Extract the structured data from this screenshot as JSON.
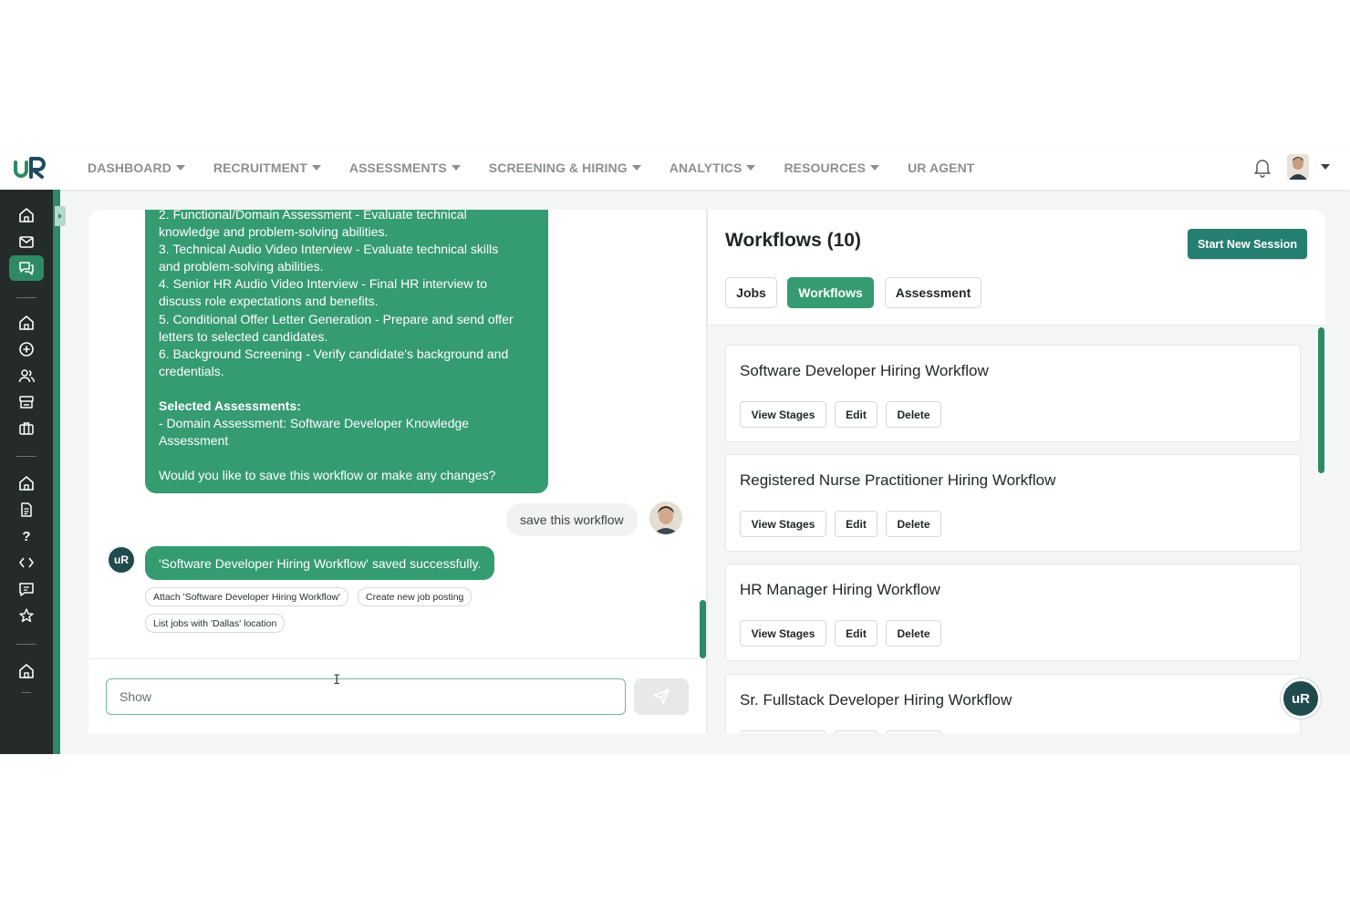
{
  "nav": {
    "items": [
      {
        "label": "DASHBOARD",
        "has_caret": true
      },
      {
        "label": "RECRUITMENT",
        "has_caret": true
      },
      {
        "label": "ASSESSMENTS",
        "has_caret": true
      },
      {
        "label": "SCREENING & HIRING",
        "has_caret": true
      },
      {
        "label": "ANALYTICS",
        "has_caret": true
      },
      {
        "label": "RESOURCES",
        "has_caret": true
      },
      {
        "label": "UR AGENT",
        "has_caret": false
      }
    ],
    "logo_text": "uR"
  },
  "sidebar": {
    "icons": [
      "home-icon",
      "mail-icon",
      "chat-icon",
      "home-icon",
      "plus-circle-icon",
      "users-icon",
      "inbox-icon",
      "briefcase-icon",
      "home-icon",
      "document-icon",
      "question-icon",
      "code-icon",
      "message-square-icon",
      "star-icon",
      "home-icon"
    ],
    "question_glyph": "?"
  },
  "chat": {
    "agent_message_lines": [
      "2. Functional/Domain Assessment - Evaluate technical",
      "knowledge and problem-solving abilities.",
      "3. Technical Audio Video Interview - Evaluate technical skills",
      "and problem-solving abilities.",
      "4. Senior HR Audio Video Interview - Final HR interview to",
      "discuss role expectations and benefits.",
      "5. Conditional Offer Letter Generation - Prepare and send offer",
      "letters to selected candidates.",
      "6. Background Screening - Verify candidate's background and",
      "credentials."
    ],
    "assessments_heading": "Selected Assessments:",
    "assessment_lines": [
      "- Domain Assessment: Software Developer Knowledge",
      "Assessment"
    ],
    "question": "Would you like to save this workflow or make any changes?",
    "user_message": "save this workflow",
    "agent_reply": "'Software Developer Hiring Workflow' saved successfully.",
    "suggestions": [
      "Attach 'Software Developer Hiring Workflow'",
      "Create new job posting",
      "List jobs with 'Dallas' location"
    ],
    "input_value": "Show",
    "avatar_label": "uR"
  },
  "workflows": {
    "title": "Workflows (10)",
    "start_button": "Start New Session",
    "tabs": [
      {
        "label": "Jobs",
        "active": false
      },
      {
        "label": "Workflows",
        "active": true
      },
      {
        "label": "Assessment",
        "active": false
      }
    ],
    "items": [
      {
        "name": "Software Developer Hiring Workflow"
      },
      {
        "name": "Registered Nurse Practitioner Hiring Workflow"
      },
      {
        "name": "HR Manager Hiring Workflow"
      },
      {
        "name": "Sr. Fullstack Developer Hiring Workflow"
      }
    ],
    "actions": {
      "view": "View Stages",
      "edit": "Edit",
      "delete": "Delete"
    }
  },
  "colors": {
    "primary_green": "#359b71",
    "dark_teal": "#257f70",
    "sidebar_bg": "#252a2a",
    "nav_text": "#8a9190"
  }
}
